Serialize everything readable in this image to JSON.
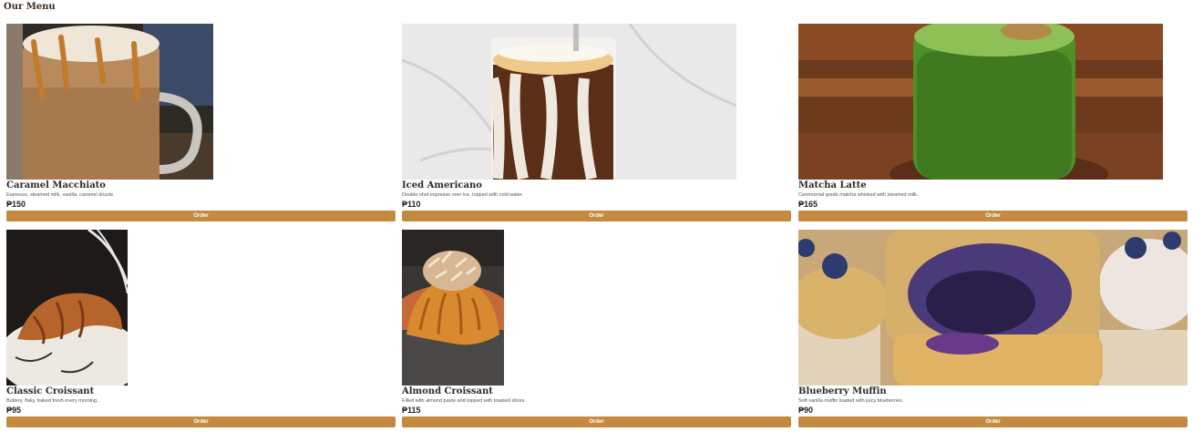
{
  "menu": {
    "title": "Our Menu",
    "order_label": "Order",
    "items": [
      {
        "name": "Caramel Macchiato",
        "description": "Espresso, steamed milk, vanilla, caramel drizzle.",
        "price": "₱150",
        "image_icon": "caramel-macchiato-photo"
      },
      {
        "name": "Iced Americano",
        "description": "Double shot espresso over ice, topped with cold water.",
        "price": "₱110",
        "image_icon": "iced-americano-photo"
      },
      {
        "name": "Matcha Latte",
        "description": "Ceremonial grade matcha whisked with steamed milk.",
        "price": "₱165",
        "image_icon": "matcha-latte-photo"
      },
      {
        "name": "Classic Croissant",
        "description": "Buttery, flaky, baked fresh every morning.",
        "price": "₱95",
        "image_icon": "classic-croissant-photo"
      },
      {
        "name": "Almond Croissant",
        "description": "Filled with almond paste and topped with toasted slices.",
        "price": "₱115",
        "image_icon": "almond-croissant-photo"
      },
      {
        "name": "Blueberry Muffin",
        "description": "Soft vanilla muffin loaded with juicy blueberries.",
        "price": "₱90",
        "image_icon": "blueberry-muffin-photo"
      }
    ]
  },
  "colors": {
    "accent": "#c48a3f",
    "title": "#3a2a1c",
    "background": "#ffffff"
  }
}
